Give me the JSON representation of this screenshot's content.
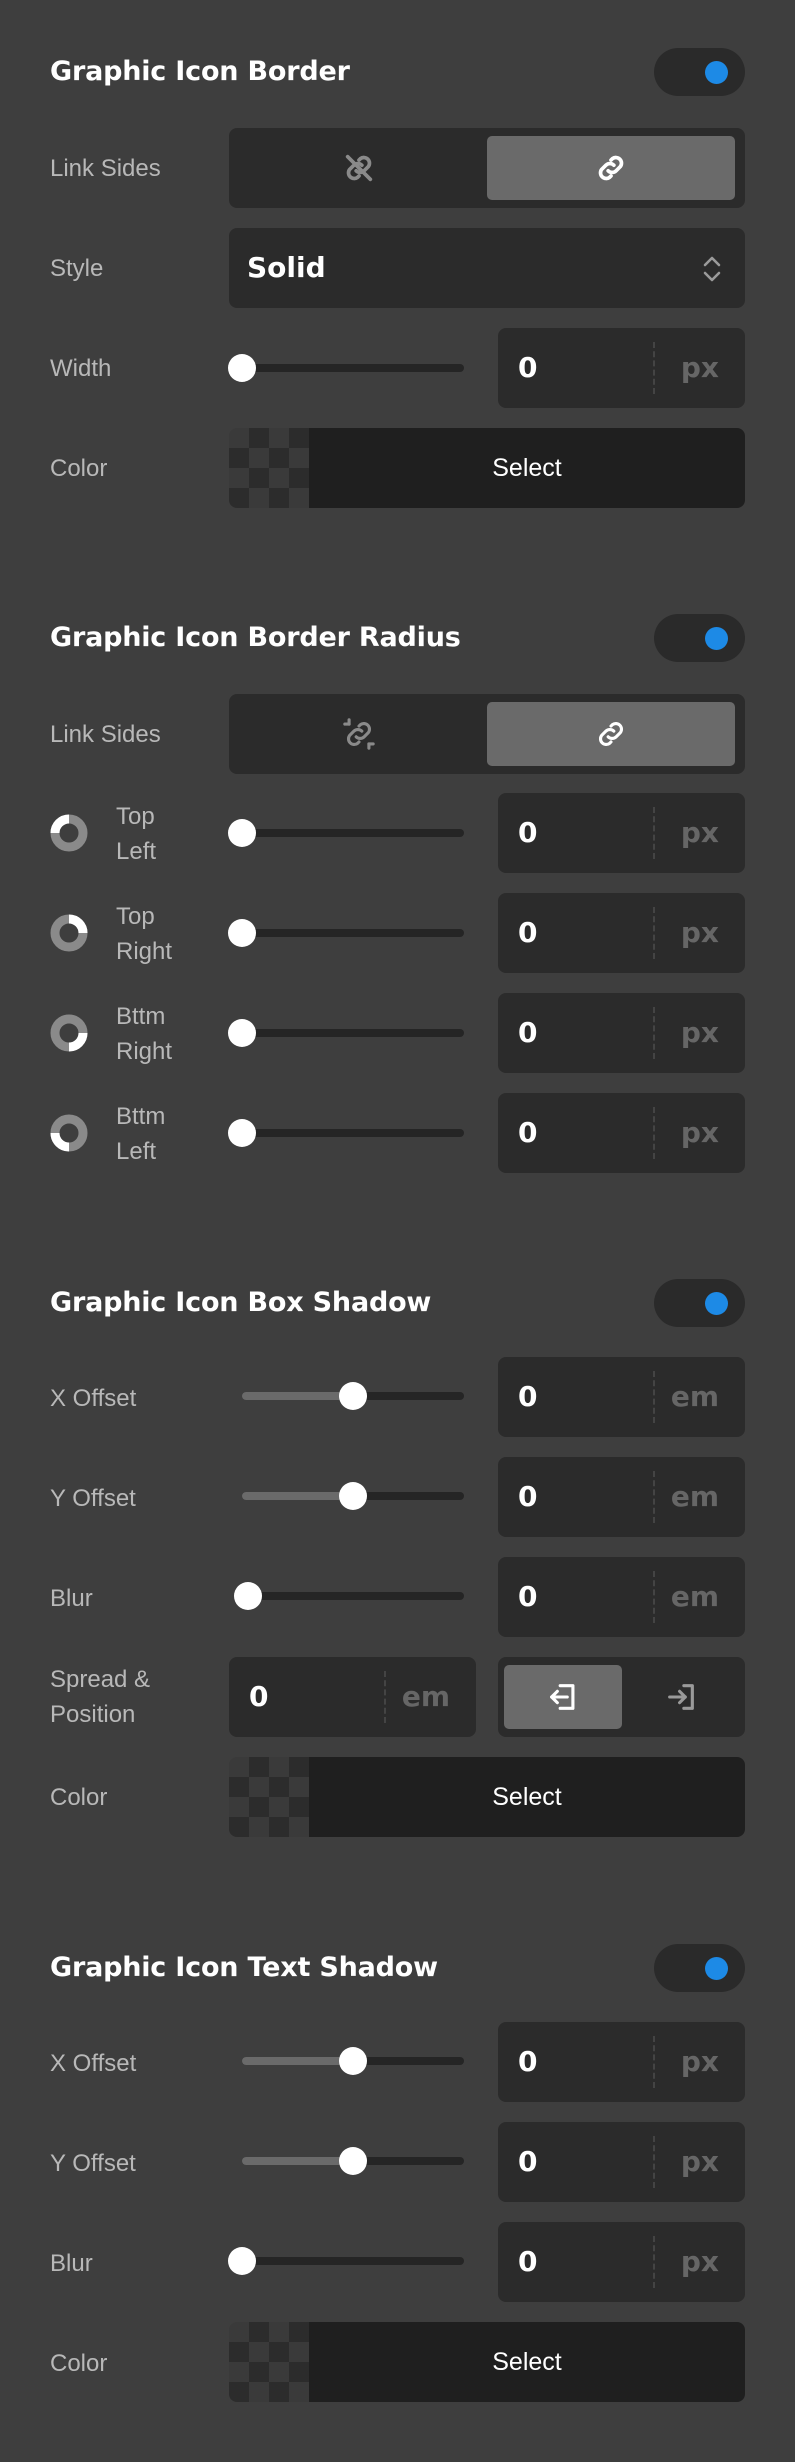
{
  "border": {
    "title": "Graphic Icon Border",
    "link_sides_label": "Link Sides",
    "style_label": "Style",
    "style_value": "Solid",
    "width_label": "Width",
    "width_value": "0",
    "width_unit": "px",
    "color_label": "Color",
    "color_button": "Select"
  },
  "radius": {
    "title": "Graphic Icon Border Radius",
    "link_sides_label": "Link Sides",
    "corners": [
      {
        "label1": "Top",
        "label2": "Left",
        "value": "0",
        "unit": "px"
      },
      {
        "label1": "Top",
        "label2": "Right",
        "value": "0",
        "unit": "px"
      },
      {
        "label1": "Bttm",
        "label2": "Right",
        "value": "0",
        "unit": "px"
      },
      {
        "label1": "Bttm",
        "label2": "Left",
        "value": "0",
        "unit": "px"
      }
    ]
  },
  "box_shadow": {
    "title": "Graphic Icon Box Shadow",
    "x_label": "X Offset",
    "x_value": "0",
    "x_unit": "em",
    "x_level": 0.5,
    "y_label": "Y Offset",
    "y_value": "0",
    "y_unit": "em",
    "y_level": 0.5,
    "blur_label": "Blur",
    "blur_value": "0",
    "blur_unit": "em",
    "blur_level": 0,
    "spread_label1": "Spread &",
    "spread_label2": "Position",
    "spread_value": "0",
    "spread_unit": "em",
    "color_label": "Color",
    "color_button": "Select"
  },
  "text_shadow": {
    "title": "Graphic Icon Text Shadow",
    "x_label": "X Offset",
    "x_value": "0",
    "x_unit": "px",
    "x_level": 0.5,
    "y_label": "Y Offset",
    "y_value": "0",
    "y_unit": "px",
    "y_level": 0.5,
    "blur_label": "Blur",
    "blur_value": "0",
    "blur_unit": "px",
    "blur_level": 0,
    "color_label": "Color",
    "color_button": "Select"
  },
  "colors": {
    "accent": "#1d8ae6",
    "panel_bg": "#3e3e3e",
    "field_bg": "#2b2b2b"
  }
}
